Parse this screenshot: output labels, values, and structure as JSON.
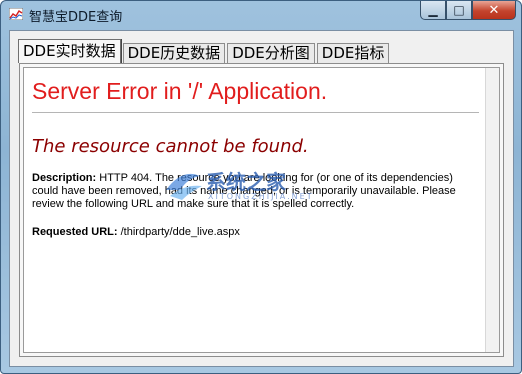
{
  "window": {
    "title": "智慧宝DDE查询",
    "minimize_glyph": "▁",
    "maximize_glyph": "□",
    "close_glyph": "✕"
  },
  "tabs": [
    {
      "label": "DDE实时数据",
      "active": true
    },
    {
      "label": "DDE历史数据",
      "active": false
    },
    {
      "label": "DDE分析图",
      "active": false
    },
    {
      "label": "DDE指标",
      "active": false
    }
  ],
  "error_page": {
    "heading": "Server Error in '/' Application.",
    "subheading": "The resource cannot be found.",
    "description_label": "Description:",
    "description_text": "HTTP 404. The resource you are looking for (or one of its dependencies) could have been removed, had its name changed, or is temporarily unavailable.  Please review the following URL and make sure that it is spelled correctly.",
    "requested_url_label": "Requested URL:",
    "requested_url": "/thirdparty/dde_live.aspx"
  },
  "watermark": {
    "text": "系统之家",
    "subtext": "XITONGZHIJIA.NET"
  },
  "colors": {
    "heading": "#e11d1d",
    "subheading": "#8b0000",
    "titlebar": "#9fc2de",
    "close_button": "#c4442d"
  }
}
